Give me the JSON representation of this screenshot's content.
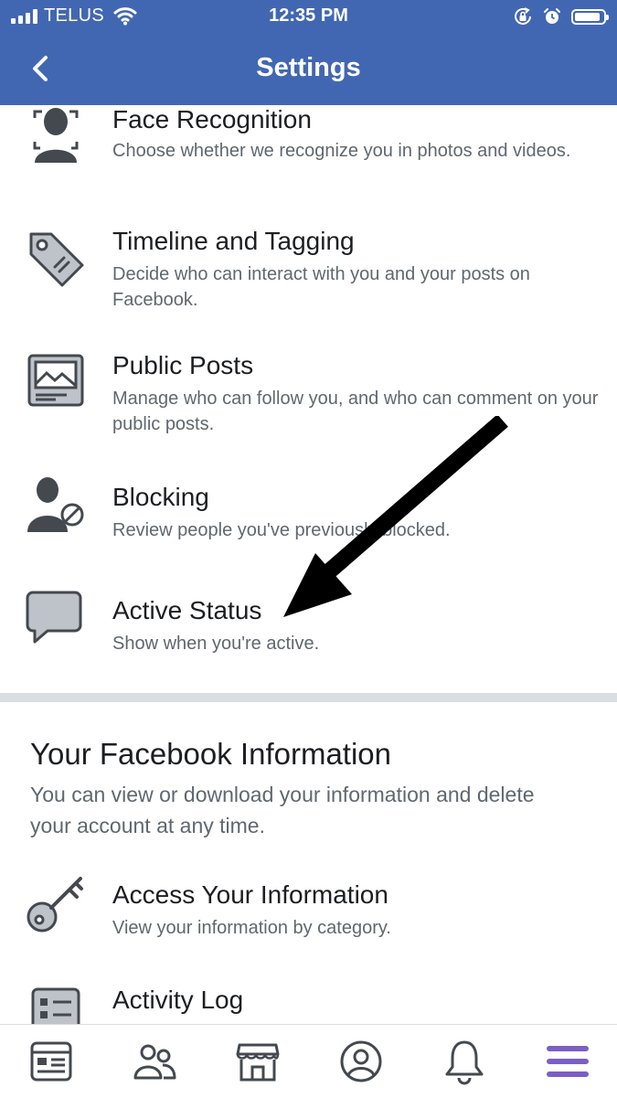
{
  "status_bar": {
    "carrier": "TELUS",
    "time": "12:35 PM",
    "battery_level": 0.9
  },
  "header": {
    "title": "Settings",
    "back_icon": "chevron-left-icon"
  },
  "privacy_items": [
    {
      "label": "Face Recognition",
      "description": "Choose whether we recognize you in photos and videos.",
      "icon": "face-recognition-icon"
    },
    {
      "label": "Timeline and Tagging",
      "description": "Decide who can interact with you and your posts on Facebook.",
      "icon": "tag-icon"
    },
    {
      "label": "Public Posts",
      "description": "Manage who can follow you, and who can comment on your public posts.",
      "icon": "public-posts-icon"
    },
    {
      "label": "Blocking",
      "description": "Review people you've previously blocked.",
      "icon": "blocked-user-icon"
    },
    {
      "label": "Active Status",
      "description": "Show when you're active.",
      "icon": "chat-bubble-icon"
    }
  ],
  "facebook_information": {
    "title": "Your Facebook Information",
    "description": "You can view or download your information and delete your account at any time.",
    "items": [
      {
        "label": "Access Your Information",
        "description": "View your information by category.",
        "icon": "key-icon"
      },
      {
        "label": "Activity Log",
        "description": "",
        "icon": "activity-log-icon"
      }
    ]
  },
  "tab_bar": {
    "tabs": [
      {
        "icon": "news-feed-icon"
      },
      {
        "icon": "friends-icon"
      },
      {
        "icon": "marketplace-icon"
      },
      {
        "icon": "profile-icon"
      },
      {
        "icon": "notifications-icon"
      },
      {
        "icon": "menu-icon",
        "active": true
      }
    ]
  },
  "colors": {
    "header": "#4267b2",
    "icon_fill": "#bec3c9",
    "icon_stroke": "#444950",
    "active_tab": "#7b5fc4"
  }
}
